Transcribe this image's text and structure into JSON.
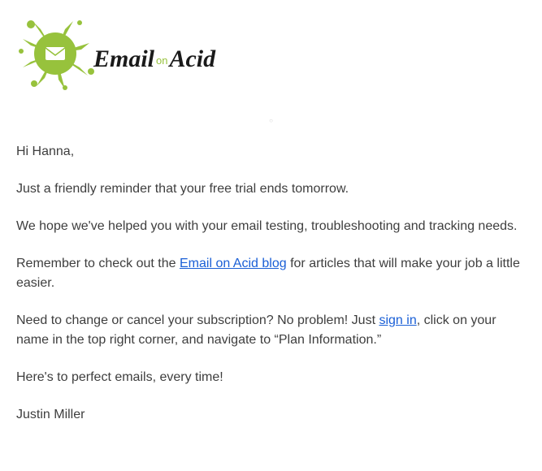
{
  "logo": {
    "brand_part1": "Email",
    "brand_on": "on",
    "brand_part2": "Acid"
  },
  "body": {
    "greeting": "Hi Hanna,",
    "p1": "Just a friendly reminder that your free trial ends tomorrow.",
    "p2": "We hope we've helped you with your email testing, troubleshooting and tracking needs.",
    "p3_pre": "Remember to check out the ",
    "p3_link": "Email on Acid blog",
    "p3_post": " for articles that will make your job a little easier.",
    "p4_pre": "Need to change or cancel your subscription? No problem! Just ",
    "p4_link": "sign in",
    "p4_post": ", click on your name in the top right corner, and navigate to “Plan Information.”",
    "p5": "Here's to perfect emails, every time!",
    "signature": "Justin Miller"
  }
}
